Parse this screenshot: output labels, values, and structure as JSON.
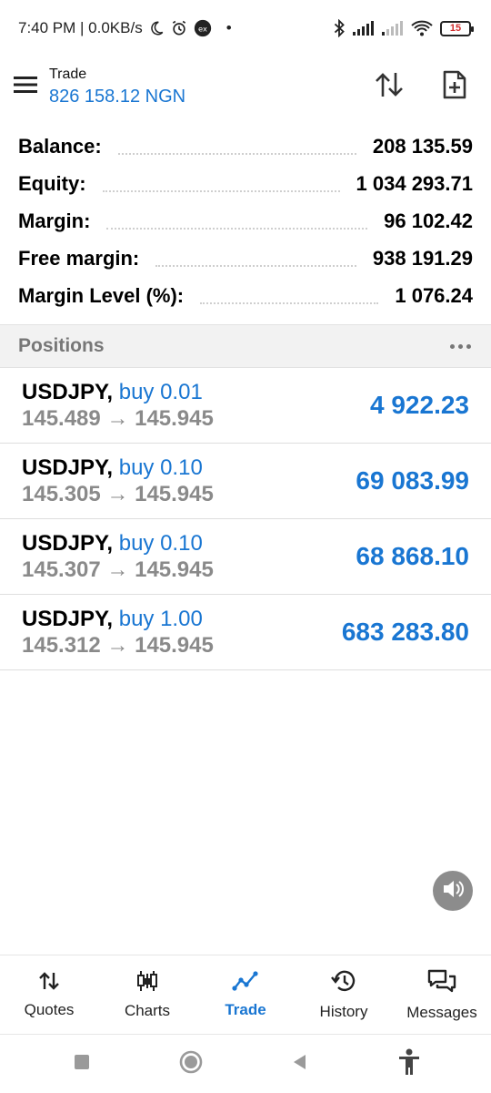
{
  "status_bar": {
    "time_speed": "7:40 PM | 0.0KB/s",
    "extra_dot": "•",
    "battery": "15",
    "icons": [
      "moon-icon",
      "alarm-icon",
      "exness-icon",
      "bluetooth-icon",
      "signal-icon",
      "signal-weak-icon",
      "wifi-icon",
      "battery-icon"
    ]
  },
  "header": {
    "title": "Trade",
    "subtitle": "826 158.12 NGN",
    "icons": [
      "menu-icon",
      "sort-icon",
      "new-order-icon"
    ]
  },
  "summary": [
    {
      "label": "Balance:",
      "value": "208 135.59"
    },
    {
      "label": "Equity:",
      "value": "1 034 293.71"
    },
    {
      "label": "Margin:",
      "value": "96 102.42"
    },
    {
      "label": "Free margin:",
      "value": "938 191.29"
    },
    {
      "label": "Margin Level (%):",
      "value": "1 076.24"
    }
  ],
  "positions": {
    "title": "Positions",
    "items": [
      {
        "symbol": "USDJPY,",
        "side": "buy 0.01",
        "prices": "145.489 → 145.945",
        "profit": "4 922.23"
      },
      {
        "symbol": "USDJPY,",
        "side": "buy 0.10",
        "prices": "145.305 → 145.945",
        "profit": "69 083.99"
      },
      {
        "symbol": "USDJPY,",
        "side": "buy 0.10",
        "prices": "145.307 → 145.945",
        "profit": "68 868.10"
      },
      {
        "symbol": "USDJPY,",
        "side": "buy 1.00",
        "prices": "145.312 → 145.945",
        "profit": "683 283.80"
      }
    ]
  },
  "bottom_nav": [
    {
      "label": "Quotes",
      "icon": "quotes-icon",
      "active": false
    },
    {
      "label": "Charts",
      "icon": "charts-icon",
      "active": false
    },
    {
      "label": "Trade",
      "icon": "trade-icon",
      "active": true
    },
    {
      "label": "History",
      "icon": "history-icon",
      "active": false
    },
    {
      "label": "Messages",
      "icon": "messages-icon",
      "active": false
    }
  ],
  "colors": {
    "accent": "#1976d2",
    "muted": "#8a8a8a",
    "section_bg": "#f2f2f2"
  }
}
